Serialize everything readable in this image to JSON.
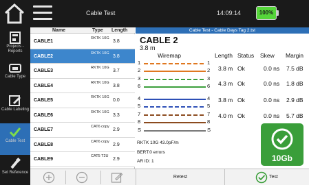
{
  "app": {
    "title": "Cable Test",
    "clock": "14:09:14",
    "battery": "100%"
  },
  "sidebar": {
    "items": [
      {
        "label": "Projects - Reports",
        "icon": "projects-icon"
      },
      {
        "label": "Cable Type",
        "icon": "cable-type-icon"
      },
      {
        "label": "Cable Labeling",
        "icon": "edit-icon"
      },
      {
        "label": "Cable Test",
        "icon": "check-icon"
      },
      {
        "label": "Set Reference",
        "icon": "set-reference-icon"
      }
    ]
  },
  "list": {
    "headers": {
      "name": "Name",
      "type": "Type",
      "length": "Length"
    },
    "rows": [
      {
        "name": "CABLE1",
        "type": "RKTK 10G",
        "length": "3.8"
      },
      {
        "name": "CABLE2",
        "type": "RKTK 10G",
        "length": "3.8"
      },
      {
        "name": "CABLE3",
        "type": "RKTK 10G",
        "length": "3.7"
      },
      {
        "name": "CABLE4",
        "type": "RKTK 10G",
        "length": "3.8"
      },
      {
        "name": "CABLE5",
        "type": "RKTK 10G",
        "length": "0.0"
      },
      {
        "name": "CABLE6",
        "type": "RKTK 10G",
        "length": "3.3"
      },
      {
        "name": "CABLE7",
        "type": "CAT6 copy",
        "length": "2.9"
      },
      {
        "name": "CABLE8",
        "type": "CAT6 copy",
        "length": "2.9"
      },
      {
        "name": "CABLE9",
        "type": "CAT5 T2U",
        "length": "2.9"
      }
    ]
  },
  "detail": {
    "header": "Cable Test - Cable Days Tag 2.tst",
    "cable_name": "CABLE 2",
    "cable_length": "3.8 m",
    "columns": {
      "wiremap": "Wiremap",
      "length": "Length",
      "status": "Status",
      "skew": "Skew",
      "margin": "Margin"
    },
    "wiremap_pins": [
      "1",
      "2",
      "3",
      "6",
      "4",
      "5",
      "7",
      "8",
      "S"
    ],
    "pairs": [
      {
        "length": "3.8 m",
        "status": "Ok",
        "skew": "0.0 ns",
        "margin": "7.5 dB"
      },
      {
        "length": "4.3 m",
        "status": "Ok",
        "skew": "0.0 ns",
        "margin": "1.8 dB"
      },
      {
        "length": "3.8 m",
        "status": "Ok",
        "skew": "0.0 ns",
        "margin": "2.9 dB"
      },
      {
        "length": "4.0 m",
        "status": "Ok",
        "skew": "0.0 ns",
        "margin": "5.7 dB"
      }
    ],
    "rktk_line": "RKTK 10G  43.0pF/m",
    "bert_line": "BERT:0 errors",
    "ar_id_line": "AR ID: 1",
    "badge_label": "10Gb"
  },
  "actions": {
    "retest_label": "Retest",
    "test_label": "Test"
  },
  "colors": {
    "accent_blue": "#2d6fb6",
    "selected_row": "#3d86cc",
    "pass_green": "#3a9e3a",
    "battery_green": "#55d63a"
  }
}
